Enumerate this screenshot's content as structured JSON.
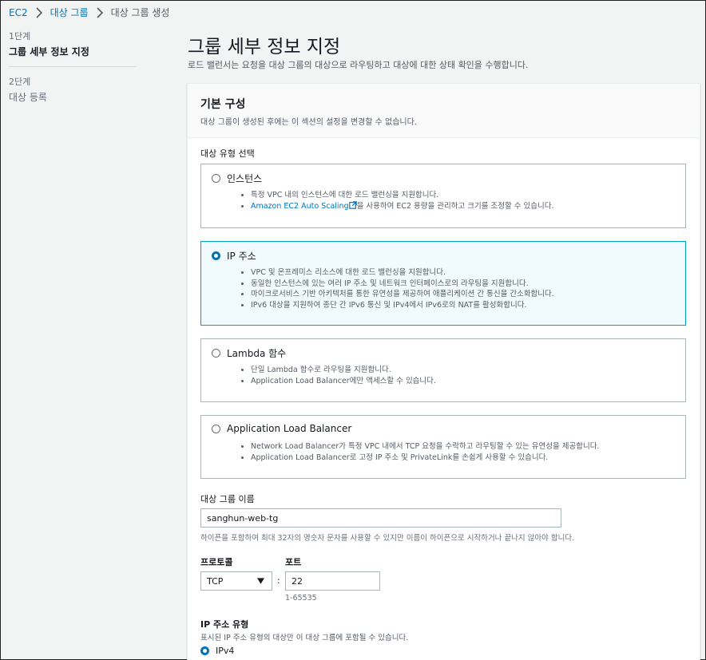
{
  "breadcrumb": {
    "items": [
      "EC2",
      "대상 그룹",
      "대상 그룹 생성"
    ]
  },
  "steps": [
    {
      "num": "1단계",
      "title": "그룹 세부 정보 지정"
    },
    {
      "num": "2단계",
      "title": "대상 등록"
    }
  ],
  "page": {
    "title": "그룹 세부 정보 지정",
    "description": "로드 밸런서는 요청을 대상 그룹의 대상으로 라우팅하고 대상에 대한 상태 확인을 수행합니다."
  },
  "basic_config": {
    "title": "기본 구성",
    "description": "대상 그룹이 생성된 후에는 이 섹션의 설정을 변경할 수 없습니다.",
    "target_type_label": "대상 유형 선택",
    "target_types": [
      {
        "label": "인스턴스",
        "bullets": [
          "특정 VPC 내의 인스턴스에 대한 로드 밸런싱을 지원합니다."
        ],
        "link_text": "Amazon EC2 Auto Scaling",
        "link_suffix": "을 사용하여 EC2 용량을 관리하고 크기를 조정할 수 있습니다."
      },
      {
        "label": "IP 주소",
        "bullets": [
          "VPC 및 온프레미스 리소스에 대한 로드 밸런싱을 지원합니다.",
          "동일한 인스턴스에 있는 여러 IP 주소 및 네트워크 인터페이스로의 라우팅을 지원합니다.",
          "마이크로서비스 기반 아키텍처를 통한 유연성을 제공하여 애플리케이션 간 통신을 간소화합니다.",
          "IPv6 대상을 지원하여 종단 간 IPv6 통신 및 IPv4에서 IPv6로의 NAT를 활성화합니다."
        ]
      },
      {
        "label": "Lambda 함수",
        "bullets": [
          "단일 Lambda 함수로 라우팅을 지원합니다.",
          "Application Load Balancer에만 액세스할 수 있습니다."
        ]
      },
      {
        "label": "Application Load Balancer",
        "bullets": [
          "Network Load Balancer가 특정 VPC 내에서 TCP 요청을 수락하고 라우팅할 수 있는 유연성을 제공합니다.",
          "Application Load Balancer로 고정 IP 주소 및 PrivateLink를 손쉽게 사용할 수 있습니다."
        ]
      }
    ],
    "selected_target_type": "IP 주소",
    "target_group_name_label": "대상 그룹 이름",
    "target_group_name_value": "sanghun-web-tg",
    "target_group_name_hint": "하이픈을 포함하여 최대 32자의 영숫자 문자를 사용할 수 있지만 이름이 하이픈으로 시작하거나 끝나지 않아야 합니다.",
    "protocol_label": "프로토콜",
    "protocol_value": "TCP",
    "port_label": "포트",
    "port_value": "22",
    "port_hint": "1-65535",
    "colon": ":",
    "ip_type_label": "IP 주소 유형",
    "ip_type_desc": "표시된 IP 주소 유형의 대상만 이 대상 그룹에 포함될 수 있습니다.",
    "ip_type_option": "IPv4"
  },
  "colors": {
    "link": "#0073bb",
    "selected_border": "#00a1c9",
    "selected_bg": "#f1faff",
    "background": "#f2f3f3"
  }
}
